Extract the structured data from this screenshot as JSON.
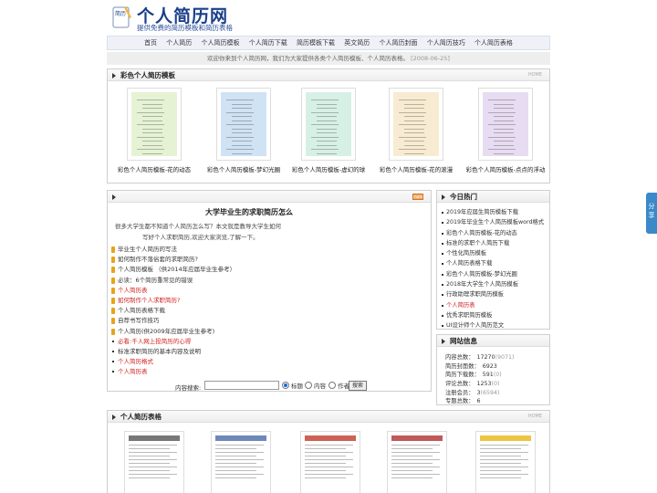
{
  "header": {
    "logo_badge": "简历",
    "title": "个人简历网",
    "subtitle": "提供免费的简历模板和简历表格"
  },
  "nav": [
    "首页",
    "个人简历",
    "个人简历模板",
    "个人简历下载",
    "简历模板下载",
    "英文简历",
    "个人简历封面",
    "个人简历技巧",
    "个人简历表格"
  ],
  "notice": {
    "text": "欢迎你来到个人简历网，我们为大家提供各类个人简历模板、个人简历表格。",
    "date": "[2008-06-25]"
  },
  "color_section": {
    "title": "彩色个人简历模板",
    "more": "HOME",
    "items": [
      {
        "caption": "彩色个人简历模板-花的动态",
        "tint": "#e6f2d4"
      },
      {
        "caption": "彩色个人简历模板-梦幻光圈",
        "tint": "#cfe3f4"
      },
      {
        "caption": "彩色个人简历模板-虚幻的球",
        "tint": "#d7f0e6"
      },
      {
        "caption": "彩色个人简历模板-花的滚漫",
        "tint": "#f7ecd2"
      },
      {
        "caption": "彩色个人简历模板-点点的浮动",
        "tint": "#e8dcf2"
      }
    ]
  },
  "article": {
    "badge": "more",
    "title": "大学毕业生的求职简历怎么",
    "desc1": "很多大学生都不知道个人简历怎么写？本文就是教导大学生如何",
    "desc2": "写好个人求职简历,欢迎大家浏览,了解一下。",
    "items": [
      {
        "text": "毕业生个人简历的写法",
        "style": "icon"
      },
      {
        "text": "如何制作不落俗套的求职简历?",
        "style": "icon"
      },
      {
        "text": "个人简历模板 （供2014年应届毕业生参考）",
        "style": "icon"
      },
      {
        "text": "必读：6个简历重常见的错误",
        "style": "icon"
      },
      {
        "text": "个人简历表",
        "style": "icon-red"
      },
      {
        "text": "如何制作个人求职简历?",
        "style": "icon-red"
      },
      {
        "text": "个人简历表格下载",
        "style": "icon"
      },
      {
        "text": "自荐书写作技巧",
        "style": "icon"
      },
      {
        "text": "个人简历(供2009年应届毕业生参考)",
        "style": "icon"
      },
      {
        "text": "必看:千人网上投简历的心得",
        "style": "dot-red"
      },
      {
        "text": "标准求职简历的基本内容及说明",
        "style": "dot"
      },
      {
        "text": "个人简历格式",
        "style": "dot-red"
      },
      {
        "text": "个人简历表",
        "style": "dot-red"
      }
    ],
    "search": {
      "label": "内容搜索:",
      "value": "",
      "options": [
        "标题",
        "内容",
        "作者"
      ],
      "selected": "标题",
      "button": "搜索"
    }
  },
  "hot": {
    "title": "今日热门",
    "items": [
      {
        "text": "2019年应届生简历模板下载",
        "red": false
      },
      {
        "text": "2019年毕业生个人简历模板word格式",
        "red": false
      },
      {
        "text": "彩色个人简历模板-花的动态",
        "red": false
      },
      {
        "text": "标准的求职个人简历下载",
        "red": false
      },
      {
        "text": "个性化简历模板",
        "red": false
      },
      {
        "text": "个人简历表格下载",
        "red": false
      },
      {
        "text": "彩色个人简历模板-梦幻光圈",
        "red": false
      },
      {
        "text": "2018年大学生个人简历模板",
        "red": false
      },
      {
        "text": "行政助理求职简历模板",
        "red": false
      },
      {
        "text": "个人简历表",
        "red": true
      },
      {
        "text": "优秀求职简历模板",
        "red": false
      },
      {
        "text": "UI设计师个人简历范文",
        "red": false
      }
    ]
  },
  "stats": {
    "title": "网站信息",
    "rows": [
      {
        "label": "内容总数：",
        "value": "17270",
        "extra": "(9071)"
      },
      {
        "label": "简历封面数：",
        "value": "6923",
        "extra": ""
      },
      {
        "label": "简历下载数：",
        "value": "591",
        "extra": "(0)"
      },
      {
        "label": "评论总数：",
        "value": "1253",
        "extra": "(0)"
      },
      {
        "label": "注册会员：",
        "value": "3",
        "extra": "(6594)"
      },
      {
        "label": "专题总数：",
        "value": "6",
        "extra": ""
      }
    ]
  },
  "table_section": {
    "title": "个人简历表格",
    "more": "HOME"
  },
  "share": "分享"
}
